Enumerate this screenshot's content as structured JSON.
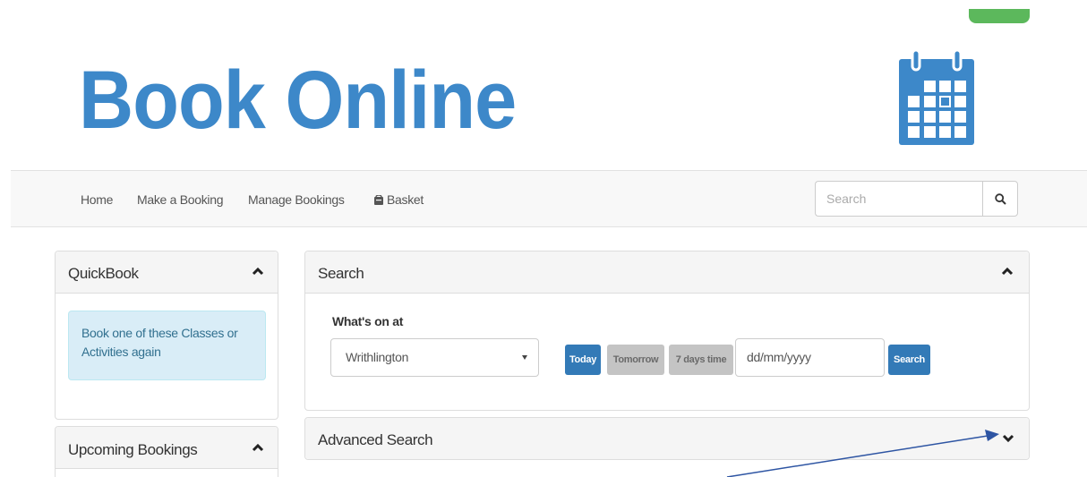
{
  "brand": {
    "title": "Book Online",
    "accent_color": "#3d88c9",
    "header_icon": "calendar-icon"
  },
  "nav": {
    "items": [
      {
        "label": "Home"
      },
      {
        "label": "Make a Booking"
      },
      {
        "label": "Manage Bookings"
      },
      {
        "label": "Basket",
        "icon": "basket-icon"
      }
    ],
    "search_placeholder": "Search",
    "search_icon": "search-icon"
  },
  "quickbook": {
    "title": "QuickBook",
    "message": "Book one of these Classes or Activities again",
    "toggle_icon": "chevron-up-icon"
  },
  "upcoming": {
    "title": "Upcoming Bookings",
    "toggle_icon": "chevron-up-icon"
  },
  "search_panel": {
    "title": "Search",
    "field_label": "What's on at",
    "selected_venue": "Writhlington",
    "buttons": {
      "today": "Today",
      "tomorrow": "Tomorrow",
      "seven_days": "7 days time",
      "search": "Search"
    },
    "date_placeholder": "dd/mm/yyyy",
    "toggle_icon": "chevron-up-icon"
  },
  "advanced_search": {
    "title": "Advanced Search",
    "toggle_icon": "chevron-down-icon"
  },
  "colors": {
    "primary": "#337ab7",
    "success": "#5cb85c",
    "info_bg": "#d9edf7",
    "annotation_arrow": "#2e55a3"
  }
}
